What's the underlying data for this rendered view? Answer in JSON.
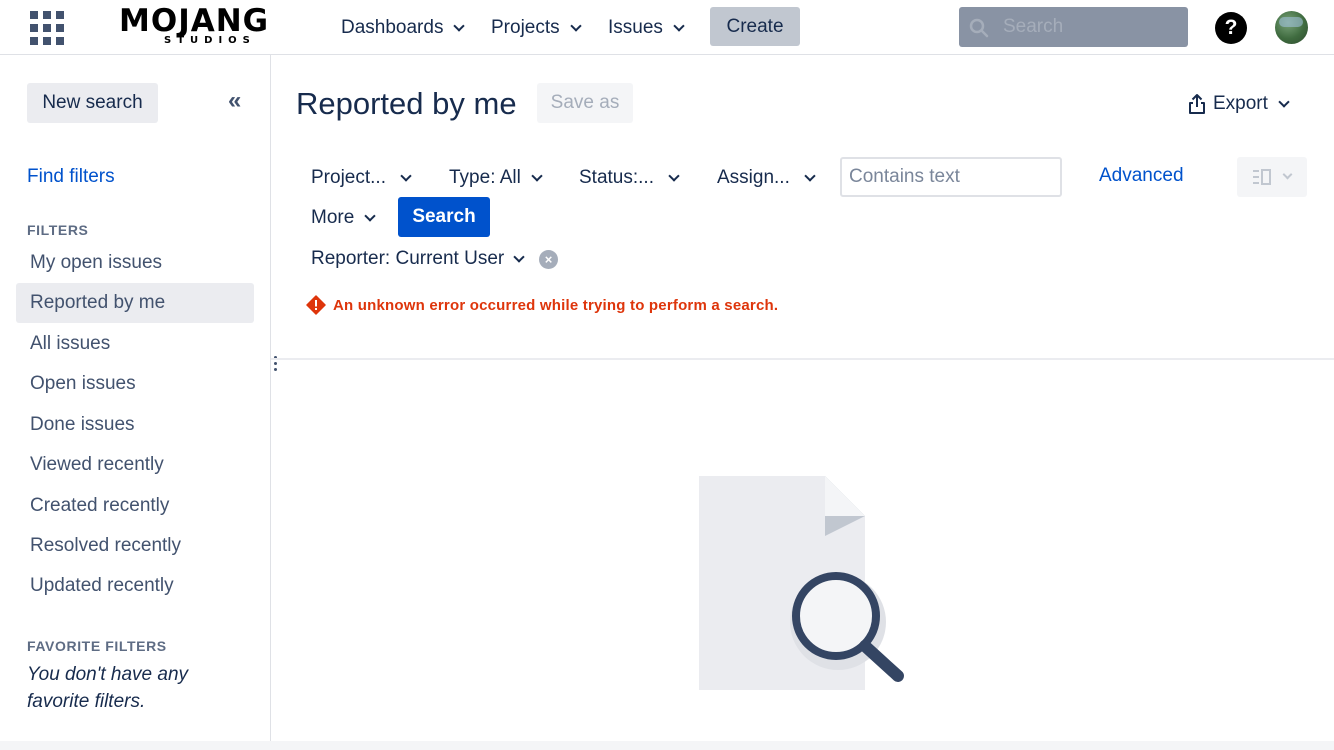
{
  "header": {
    "app_switcher_icon": "grid-icon",
    "logo": {
      "word": "MOJANG",
      "sub": "STUDIOS"
    },
    "nav": [
      {
        "label": "Dashboards"
      },
      {
        "label": "Projects"
      },
      {
        "label": "Issues"
      }
    ],
    "create_label": "Create",
    "search_placeholder": "Search",
    "help_symbol": "?",
    "avatar_icon": "user-avatar"
  },
  "sidebar": {
    "new_search_label": "New search",
    "collapse_symbol": "«",
    "find_filters_label": "Find filters",
    "filters_heading": "FILTERS",
    "items": [
      {
        "label": "My open issues"
      },
      {
        "label": "Reported by me",
        "active": true
      },
      {
        "label": "All issues"
      },
      {
        "label": "Open issues"
      },
      {
        "label": "Done issues"
      },
      {
        "label": "Viewed recently"
      },
      {
        "label": "Created recently"
      },
      {
        "label": "Resolved recently"
      },
      {
        "label": "Updated recently"
      }
    ],
    "favorites_heading": "FAVORITE FILTERS",
    "favorites_empty": "You don't have any favorite filters."
  },
  "main": {
    "title": "Reported by me",
    "save_as_label": "Save as",
    "export_label": "Export",
    "criteria": {
      "project": "Project...",
      "type": "Type: All",
      "status": "Status:...",
      "assignee": "Assign...",
      "text_placeholder": "Contains text",
      "advanced_label": "Advanced",
      "more_label": "More",
      "search_label": "Search"
    },
    "reporter_label": "Reporter: Current User",
    "error_message": "An unknown error occurred while trying to perform a search.",
    "colors": {
      "error": "#de350b",
      "primary": "#0052cc",
      "text": "#172b4d"
    }
  }
}
